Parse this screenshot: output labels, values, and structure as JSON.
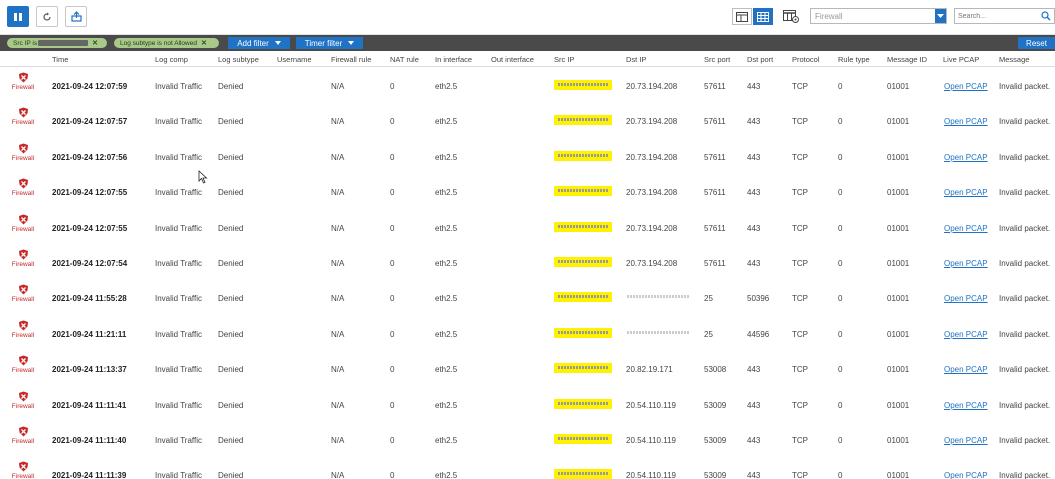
{
  "toolbar": {
    "pause_icon": "pause-icon",
    "refresh_icon": "refresh-icon",
    "export_icon": "export-icon",
    "module_select_value": "Firewall",
    "search_placeholder": "Search..."
  },
  "filters": {
    "chips": [
      {
        "label": "Src IP is"
      },
      {
        "label": "Log subtype is not Allowed"
      }
    ],
    "add_filter": "Add filter",
    "timer_filter": "Timer filter",
    "reset": "Reset"
  },
  "columns": [
    "Time",
    "Log comp",
    "Log subtype",
    "Username",
    "Firewall rule",
    "NAT rule",
    "In interface",
    "Out interface",
    "Src IP",
    "Dst IP",
    "Src port",
    "Dst port",
    "Protocol",
    "Rule type",
    "Message ID",
    "Live PCAP",
    "Message"
  ],
  "module_label": "Firewall",
  "rows": [
    {
      "time": "2021-09-24 12:07:59",
      "log_comp": "Invalid Traffic",
      "log_subtype": "Denied",
      "firewall_rule": "N/A",
      "nat_rule": "0",
      "in_interface": "eth2.5",
      "dst_ip": "20.73.194.208",
      "src_port": "57611",
      "dst_port": "443",
      "protocol": "TCP",
      "rule_type": "0",
      "message_id": "01001",
      "live_pcap": "Open PCAP",
      "message": "Invalid packet."
    },
    {
      "time": "2021-09-24 12:07:57",
      "log_comp": "Invalid Traffic",
      "log_subtype": "Denied",
      "firewall_rule": "N/A",
      "nat_rule": "0",
      "in_interface": "eth2.5",
      "dst_ip": "20.73.194.208",
      "src_port": "57611",
      "dst_port": "443",
      "protocol": "TCP",
      "rule_type": "0",
      "message_id": "01001",
      "live_pcap": "Open PCAP",
      "message": "Invalid packet."
    },
    {
      "time": "2021-09-24 12:07:56",
      "log_comp": "Invalid Traffic",
      "log_subtype": "Denied",
      "firewall_rule": "N/A",
      "nat_rule": "0",
      "in_interface": "eth2.5",
      "dst_ip": "20.73.194.208",
      "src_port": "57611",
      "dst_port": "443",
      "protocol": "TCP",
      "rule_type": "0",
      "message_id": "01001",
      "live_pcap": "Open PCAP",
      "message": "Invalid packet."
    },
    {
      "time": "2021-09-24 12:07:55",
      "log_comp": "Invalid Traffic",
      "log_subtype": "Denied",
      "firewall_rule": "N/A",
      "nat_rule": "0",
      "in_interface": "eth2.5",
      "dst_ip": "20.73.194.208",
      "src_port": "57611",
      "dst_port": "443",
      "protocol": "TCP",
      "rule_type": "0",
      "message_id": "01001",
      "live_pcap": "Open PCAP",
      "message": "Invalid packet."
    },
    {
      "time": "2021-09-24 12:07:55",
      "log_comp": "Invalid Traffic",
      "log_subtype": "Denied",
      "firewall_rule": "N/A",
      "nat_rule": "0",
      "in_interface": "eth2.5",
      "dst_ip": "20.73.194.208",
      "src_port": "57611",
      "dst_port": "443",
      "protocol": "TCP",
      "rule_type": "0",
      "message_id": "01001",
      "live_pcap": "Open PCAP",
      "message": "Invalid packet."
    },
    {
      "time": "2021-09-24 12:07:54",
      "log_comp": "Invalid Traffic",
      "log_subtype": "Denied",
      "firewall_rule": "N/A",
      "nat_rule": "0",
      "in_interface": "eth2.5",
      "dst_ip": "20.73.194.208",
      "src_port": "57611",
      "dst_port": "443",
      "protocol": "TCP",
      "rule_type": "0",
      "message_id": "01001",
      "live_pcap": "Open PCAP",
      "message": "Invalid packet."
    },
    {
      "time": "2021-09-24 11:55:28",
      "log_comp": "Invalid Traffic",
      "log_subtype": "Denied",
      "firewall_rule": "N/A",
      "nat_rule": "0",
      "in_interface": "eth2.5",
      "dst_ip": "",
      "src_port": "25",
      "dst_port": "50396",
      "protocol": "TCP",
      "rule_type": "0",
      "message_id": "01001",
      "live_pcap": "Open PCAP",
      "message": "Invalid packet."
    },
    {
      "time": "2021-09-24 11:21:11",
      "log_comp": "Invalid Traffic",
      "log_subtype": "Denied",
      "firewall_rule": "N/A",
      "nat_rule": "0",
      "in_interface": "eth2.5",
      "dst_ip": "",
      "src_port": "25",
      "dst_port": "44596",
      "protocol": "TCP",
      "rule_type": "0",
      "message_id": "01001",
      "live_pcap": "Open PCAP",
      "message": "Invalid packet."
    },
    {
      "time": "2021-09-24 11:13:37",
      "log_comp": "Invalid Traffic",
      "log_subtype": "Denied",
      "firewall_rule": "N/A",
      "nat_rule": "0",
      "in_interface": "eth2.5",
      "dst_ip": "20.82.19.171",
      "src_port": "53008",
      "dst_port": "443",
      "protocol": "TCP",
      "rule_type": "0",
      "message_id": "01001",
      "live_pcap": "Open PCAP",
      "message": "Invalid packet."
    },
    {
      "time": "2021-09-24 11:11:41",
      "log_comp": "Invalid Traffic",
      "log_subtype": "Denied",
      "firewall_rule": "N/A",
      "nat_rule": "0",
      "in_interface": "eth2.5",
      "dst_ip": "20.54.110.119",
      "src_port": "53009",
      "dst_port": "443",
      "protocol": "TCP",
      "rule_type": "0",
      "message_id": "01001",
      "live_pcap": "Open PCAP",
      "message": "Invalid packet."
    },
    {
      "time": "2021-09-24 11:11:40",
      "log_comp": "Invalid Traffic",
      "log_subtype": "Denied",
      "firewall_rule": "N/A",
      "nat_rule": "0",
      "in_interface": "eth2.5",
      "dst_ip": "20.54.110.119",
      "src_port": "53009",
      "dst_port": "443",
      "protocol": "TCP",
      "rule_type": "0",
      "message_id": "01001",
      "live_pcap": "Open PCAP",
      "message": "Invalid packet."
    },
    {
      "time": "2021-09-24 11:11:39",
      "log_comp": "Invalid Traffic",
      "log_subtype": "Denied",
      "firewall_rule": "N/A",
      "nat_rule": "0",
      "in_interface": "eth2.5",
      "dst_ip": "20.54.110.119",
      "src_port": "53009",
      "dst_port": "443",
      "protocol": "TCP",
      "rule_type": "0",
      "message_id": "01001",
      "live_pcap": "Open PCAP",
      "message": "Invalid packet."
    }
  ],
  "colors": {
    "accent": "#1f72c4",
    "filterbar": "#4a4a4a",
    "chip": "#a9c98a",
    "highlight": "#fff200",
    "firewall_red": "#c62828"
  }
}
